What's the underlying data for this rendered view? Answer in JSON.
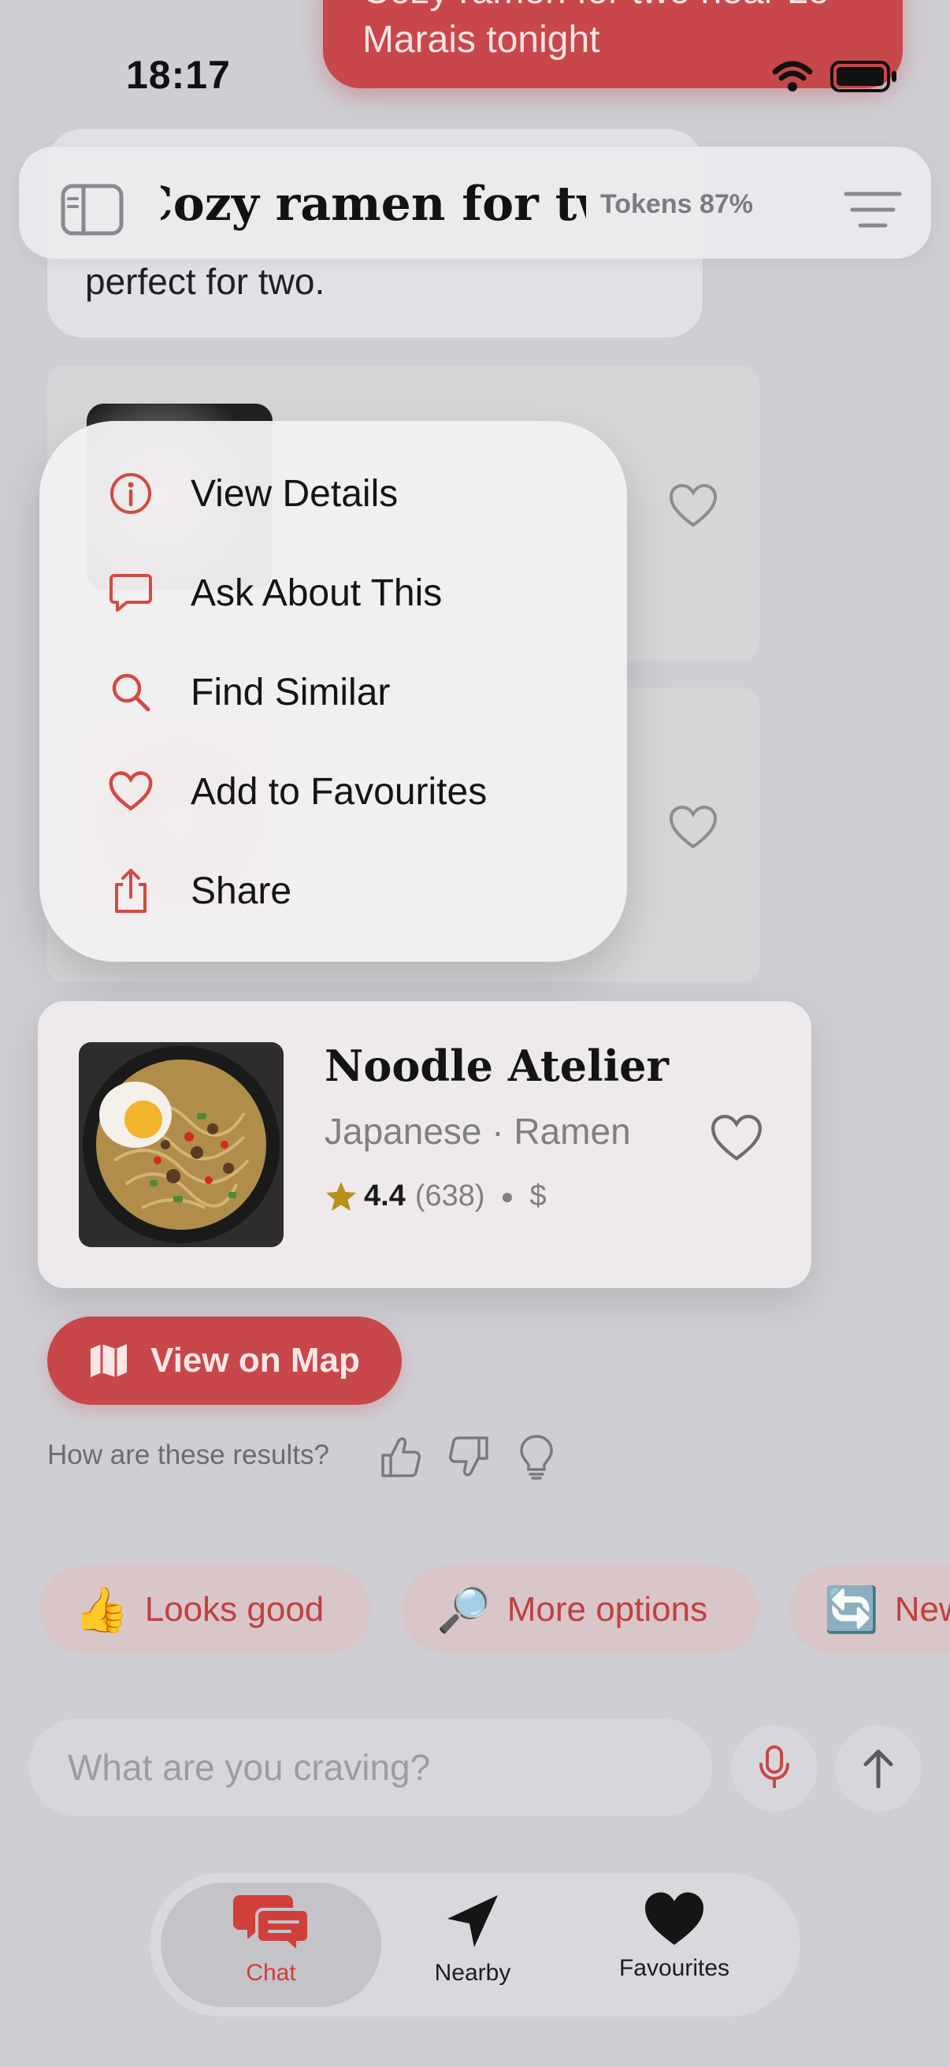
{
  "status_bar": {
    "time": "18:17"
  },
  "user_message": {
    "line1": "Cozy ramen for two near Le",
    "line2": "Marais tonight"
  },
  "header": {
    "title": "Cozy ramen for two near",
    "tokens": "Tokens 87%"
  },
  "assistant_message": {
    "text": "perfect for two."
  },
  "context_menu": {
    "items": [
      {
        "label": "View Details",
        "icon": "info-circle-icon"
      },
      {
        "label": "Ask About This",
        "icon": "chat-bubble-icon"
      },
      {
        "label": "Find Similar",
        "icon": "magnifier-icon"
      },
      {
        "label": "Add to Favourites",
        "icon": "heart-icon"
      },
      {
        "label": "Share",
        "icon": "share-icon"
      }
    ]
  },
  "focused_card": {
    "name": "Noodle Atelier",
    "cuisine": "Japanese · Ramen",
    "rating": "4.4",
    "reviews": "(638)",
    "price": "$"
  },
  "map_button": {
    "label": "View on Map"
  },
  "feedback": {
    "question": "How are these results?"
  },
  "quick_replies": [
    {
      "emoji": "👍",
      "label": "Looks good"
    },
    {
      "emoji": "🔎",
      "label": "More options"
    },
    {
      "emoji": "🔄",
      "label": "New"
    }
  ],
  "input": {
    "placeholder": "What are you craving?"
  },
  "tab_bar": {
    "tabs": [
      {
        "label": "Chat",
        "active": true
      },
      {
        "label": "Nearby",
        "active": false
      },
      {
        "label": "Favourites",
        "active": false
      }
    ]
  },
  "colors": {
    "accent": "#c7474a",
    "background": "#cfced4",
    "star": "#b8901c"
  }
}
